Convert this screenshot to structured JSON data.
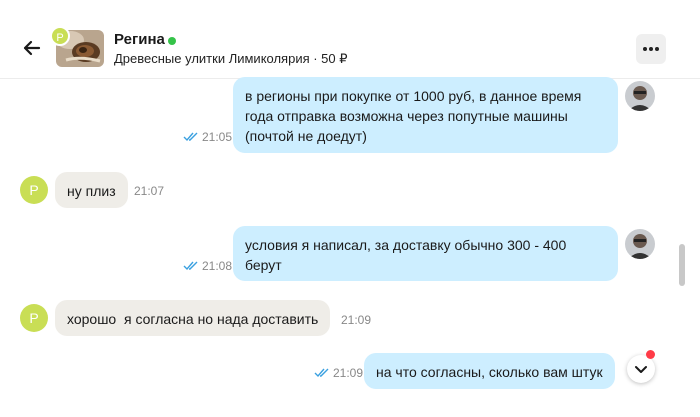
{
  "header": {
    "name": "Регина",
    "avatar_letter": "P",
    "subtitle": "Древесные улитки Лимиколярия · 50 ₽",
    "online_color": "#35c349"
  },
  "messages": [
    {
      "direction": "out",
      "lines": [
        "в регионы при покупке от 1000 руб, в данное время",
        "года отправка возможна через попутные машины",
        "(почтой не доедут)"
      ],
      "time": "21:05",
      "read": true
    },
    {
      "direction": "in",
      "lines": [
        "ну плиз"
      ],
      "time": "21:07",
      "avatar_letter": "P"
    },
    {
      "direction": "out",
      "lines": [
        "условия я написал, за доставку обычно 300 - 400",
        "берут"
      ],
      "time": "21:08",
      "read": true
    },
    {
      "direction": "in",
      "lines": [
        "хорошо  я согласна но нада доставить"
      ],
      "time": "21:09",
      "avatar_letter": "P"
    },
    {
      "direction": "out",
      "lines": [
        "на что согласны, сколько вам штук"
      ],
      "time": "21:09",
      "read": true
    }
  ],
  "colors": {
    "outgoing_bubble": "#cdeeff",
    "incoming_bubble": "#efede8",
    "avatar": "#c9de55",
    "read_check": "#3aa0e0"
  },
  "icons": {
    "back": "arrow-left-icon",
    "menu": "more-dots-icon",
    "scroll_down": "chevron-down-icon",
    "read": "double-check-icon"
  }
}
